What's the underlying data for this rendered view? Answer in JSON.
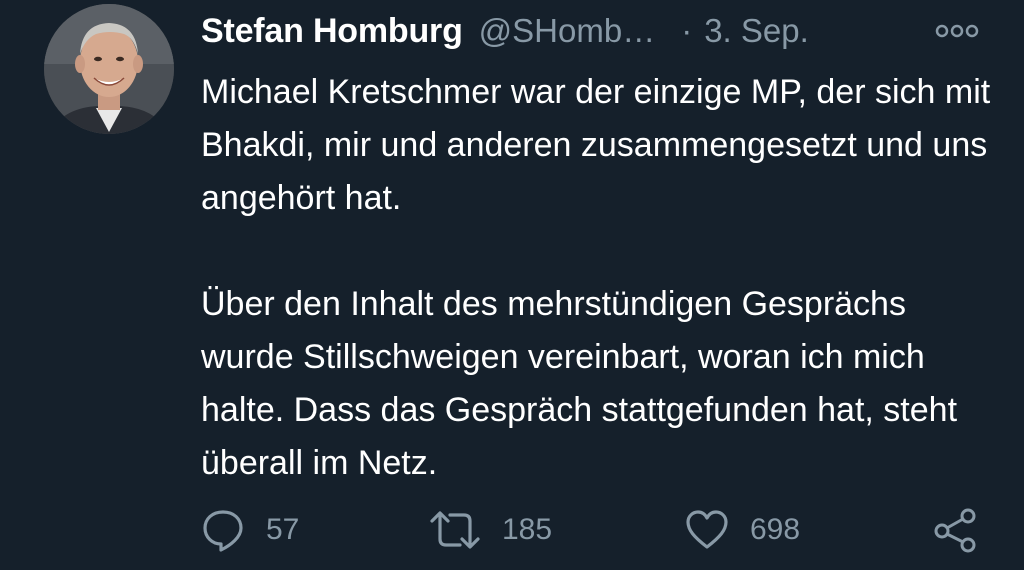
{
  "tweet": {
    "author_name": "Stefan Homburg",
    "handle": "@SHomb…",
    "separator": "·",
    "date": "3. Sep.",
    "paragraphs": [
      "Michael Kretschmer war der einzige MP, der sich mit Bhakdi, mir und anderen zusammengesetzt und uns angehört hat.",
      "Über den Inhalt des mehrstündigen Gesprächs wurde Stillschweigen vereinbart, woran ich mich halte. Dass das Gespräch stattgefunden hat, steht überall im Netz."
    ],
    "actions": {
      "reply_count": "57",
      "retweet_count": "185",
      "like_count": "698"
    }
  },
  "icons": {
    "more": "more-horizontal-icon",
    "reply": "reply-icon",
    "retweet": "retweet-icon",
    "like": "heart-icon",
    "share": "share-icon"
  },
  "colors": {
    "background": "#15202b",
    "text_primary": "#ffffff",
    "text_secondary": "#8899a6"
  }
}
